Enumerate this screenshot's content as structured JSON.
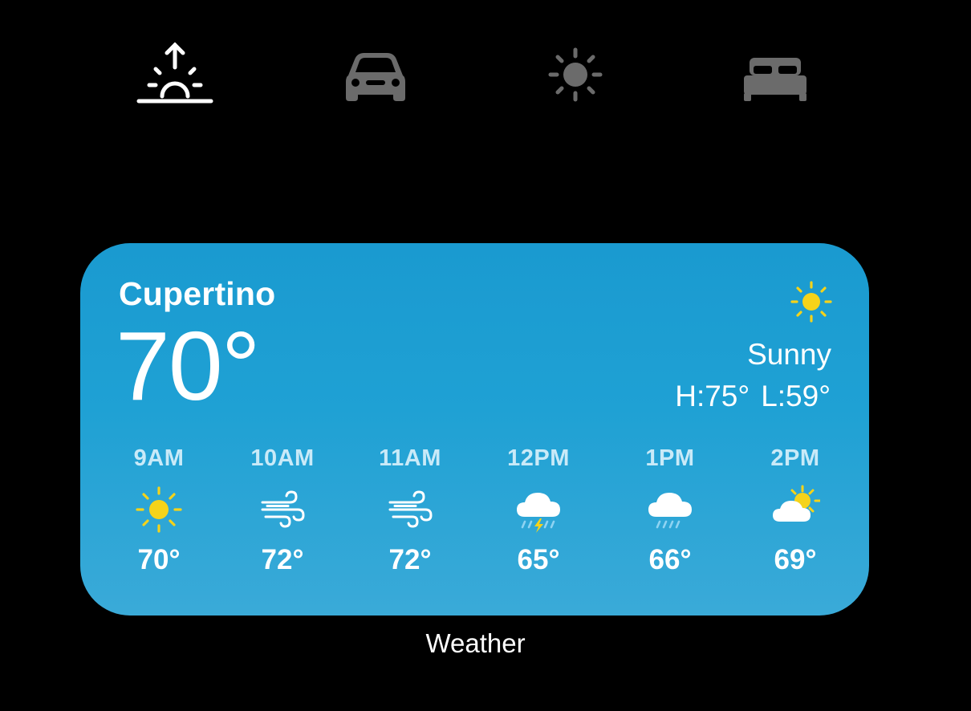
{
  "focus_modes": [
    {
      "icon": "sunrise-icon",
      "active": true
    },
    {
      "icon": "car-icon",
      "active": false
    },
    {
      "icon": "sun-icon",
      "active": false
    },
    {
      "icon": "bed-icon",
      "active": false
    }
  ],
  "widget": {
    "city": "Cupertino",
    "temperature": "70°",
    "condition": "Sunny",
    "condition_icon": "sun-icon",
    "high": "H:75°",
    "low": "L:59°",
    "hourly": [
      {
        "time": "9AM",
        "icon": "sun-icon",
        "temp": "70°"
      },
      {
        "time": "10AM",
        "icon": "wind-icon",
        "temp": "72°"
      },
      {
        "time": "11AM",
        "icon": "wind-icon",
        "temp": "72°"
      },
      {
        "time": "12PM",
        "icon": "thunderstorm-icon",
        "temp": "65°"
      },
      {
        "time": "1PM",
        "icon": "rain-icon",
        "temp": "66°"
      },
      {
        "time": "2PM",
        "icon": "partly-cloudy-icon",
        "temp": "69°"
      }
    ]
  },
  "caption": "Weather",
  "colors": {
    "background": "#000000",
    "widget_top": "#1a9ad0",
    "widget_bottom": "#3aaad8",
    "active_icon": "#ffffff",
    "inactive_icon": "#6b6b6b",
    "sun": "#f5d31a"
  }
}
